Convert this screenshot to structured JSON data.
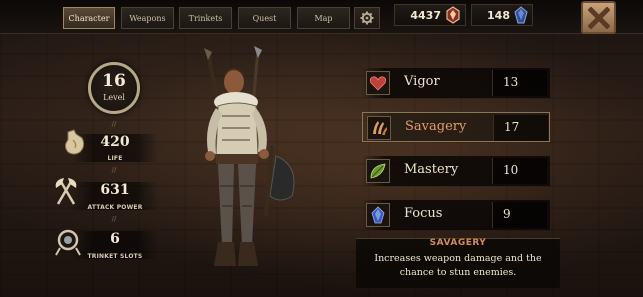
{
  "tabs": [
    {
      "label": "Character",
      "active": true
    },
    {
      "label": "Weapons",
      "active": false
    },
    {
      "label": "Trinkets",
      "active": false
    },
    {
      "label": "Quest",
      "active": false
    },
    {
      "label": "Map",
      "active": false
    }
  ],
  "currency": {
    "gold": "4437",
    "gems": "148"
  },
  "level": {
    "value": "16",
    "label": "Level"
  },
  "stats": [
    {
      "value": "420",
      "label": "LIFE",
      "icon": "life-gourd-icon"
    },
    {
      "value": "631",
      "label": "ATTACK POWER",
      "icon": "crossed-axes-icon"
    },
    {
      "value": "6",
      "label": "TRINKET SLOTS",
      "icon": "trinket-medallion-icon"
    }
  ],
  "attributes": [
    {
      "name": "Vigor",
      "value": "13",
      "icon": "heart-icon",
      "color": "#c0403a",
      "selected": false
    },
    {
      "name": "Savagery",
      "value": "17",
      "icon": "claw-icon",
      "color": "#c07a3a",
      "selected": true
    },
    {
      "name": "Mastery",
      "value": "10",
      "icon": "leaf-icon",
      "color": "#7aa03a",
      "selected": false
    },
    {
      "name": "Focus",
      "value": "9",
      "icon": "crystal-icon",
      "color": "#4a6ad0",
      "selected": false
    }
  ],
  "description": {
    "title": "SAVAGERY",
    "text": "Increases weapon damage and the chance to stun enemies."
  },
  "colors": {
    "accent": "#e49a6a",
    "panel": "#0a0705",
    "text": "#eee3cb"
  }
}
